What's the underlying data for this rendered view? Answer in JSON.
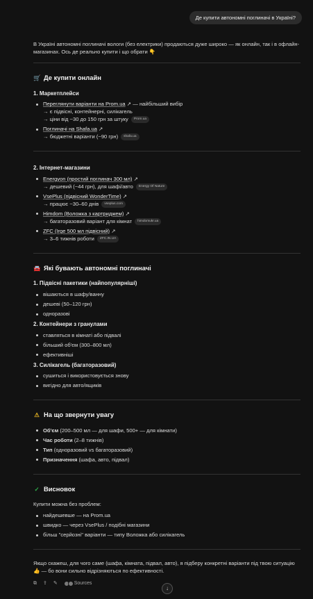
{
  "user_message": "Де купити автономні поглиначі в Україні?",
  "intro": "В Україні автономні поглиначі вологи (без електрики) продаються дуже широко — як онлайн, так і в офлайн-магазинах. Ось де реально купити і що обрати 👇",
  "online": {
    "title": "Де купити онлайн",
    "marketplaces": {
      "title": "1. Маркетплейси",
      "items": [
        {
          "link": "Переглянути варіанти на Prom.ua",
          "link_suffix": "— найбільший вибір",
          "sub": [
            "→ є підвісні, контейнерні, силікагель",
            "→ ціни від ~30 до 150 грн за штуку"
          ],
          "chip": "Prom.ua"
        },
        {
          "link": "Поглиначі на Shafa.ua",
          "link_suffix": "",
          "sub": [
            "→ бюджетні варіанти (~90 грн)"
          ],
          "chip": "shafa.ua"
        }
      ]
    },
    "shops": {
      "title": "2. Інтернет-магазини",
      "items": [
        {
          "link": "Energyon (простий поглинач 300 мл)",
          "sub": "→ дешевий (~44 грн), для шафі/авто",
          "chip": "Energy Of Nature"
        },
        {
          "link": "VsePlus (підвісний WonderTime)",
          "sub": "→ працює ~30–60 днів",
          "chip": "vseplus.com"
        },
        {
          "link": "Himdom (Воложка з картриджем)",
          "sub": "→ багаторазовий варіант для кімнат",
          "chip": "himdomukr.ua"
        },
        {
          "link": "ZFC (Irge 500 мл підвісний)",
          "sub": "→ 3–6 тижнів роботи",
          "chip": "ZFC.IN.UA"
        }
      ]
    }
  },
  "types": {
    "title": "Які бувають автономні поглиначі",
    "groups": [
      {
        "title": "1. Підвісні пакетики (найпопулярніші)",
        "items": [
          "вішаються в шафу/ванну",
          "дешеві (50–120 грн)",
          "одноразові"
        ]
      },
      {
        "title": "2. Контейнери з гранулами",
        "items": [
          "ставляться в кімнаті або підвалі",
          "більший об'єм (300–800 мл)",
          "ефективніші"
        ]
      },
      {
        "title": "3. Силікагель (багаторазовий)",
        "items": [
          "сушиться і використовується знову",
          "вигідно для авто/ящиків"
        ]
      }
    ]
  },
  "attention": {
    "title": "На що звернути увагу",
    "items": [
      {
        "bold": "Об'єм",
        "rest": "(200–500 мл — для шафи, 500+ — для кімнати)"
      },
      {
        "bold": "Час роботи",
        "rest": "(2–8 тижнів)"
      },
      {
        "bold": "Тип",
        "rest": "(одноразовий vs багаторазовий)"
      },
      {
        "bold": "Призначення",
        "rest": "(шафа, авто, підвал)"
      }
    ]
  },
  "conclusion": {
    "title": "Висновок",
    "lead": "Купити можна без проблем:",
    "items": [
      "найдешевше — на Prom.ua",
      "швидко — через VsePlus / подібні магазини",
      "більш \"серйозні\" варіанти — типу Воложка або силікагель"
    ]
  },
  "closing": "Якщо скажеш, для чого саме (шафа, кімната, підвал, авто), я підберу конкретні варіанти під твою ситуацію 👍 — бо вони сильно відрізняються по ефективності.",
  "footer": {
    "sources_label": "Sources"
  },
  "icons": {
    "online": "cart-icon",
    "types": "car-icon",
    "attention": "warning-icon",
    "conclusion": "check-icon"
  },
  "colors": {
    "background": "#121212",
    "check": "#2fb24c",
    "warning": "#e6b422"
  }
}
